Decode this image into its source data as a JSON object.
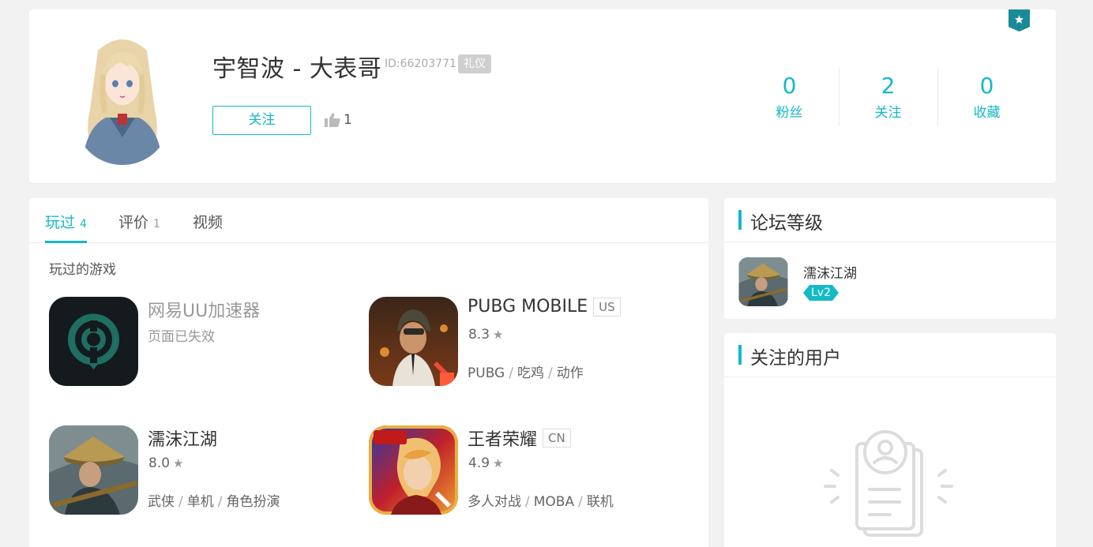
{
  "profile": {
    "username": "宇智波 - 大表哥",
    "user_id": "ID:66203771",
    "badge": "礼仪",
    "follow_label": "关注",
    "likes": "1",
    "stats": [
      {
        "value": "0",
        "label": "粉丝"
      },
      {
        "value": "2",
        "label": "关注"
      },
      {
        "value": "0",
        "label": "收藏"
      }
    ]
  },
  "tabs": [
    {
      "label": "玩过",
      "count": "4"
    },
    {
      "label": "评价",
      "count": "1"
    },
    {
      "label": "视频",
      "count": ""
    }
  ],
  "games_section_title": "玩过的游戏",
  "games": [
    {
      "name": "网易UU加速器",
      "status": "页面已失效",
      "rating": "",
      "region": "",
      "tags": [],
      "icon": "uu-accelerator-icon"
    },
    {
      "name": "PUBG MOBILE",
      "status": "",
      "rating": "8.3",
      "region": "US",
      "tags": [
        "PUBG",
        "吃鸡",
        "动作"
      ],
      "icon": "pubg-icon"
    },
    {
      "name": "濡沫江湖",
      "status": "",
      "rating": "8.0",
      "region": "",
      "tags": [
        "武侠",
        "单机",
        "角色扮演"
      ],
      "icon": "rumo-jianghu-icon"
    },
    {
      "name": "王者荣耀",
      "status": "",
      "rating": "4.9",
      "region": "CN",
      "tags": [
        "多人对战",
        "MOBA",
        "联机"
      ],
      "icon": "honor-of-kings-icon"
    }
  ],
  "forum_level": {
    "title": "论坛等级",
    "game_name": "濡沫江湖",
    "level": "Lv2"
  },
  "followed_users": {
    "title": "关注的用户"
  },
  "colors": {
    "accent": "#14b9c8",
    "background": "#f2f2f2"
  }
}
